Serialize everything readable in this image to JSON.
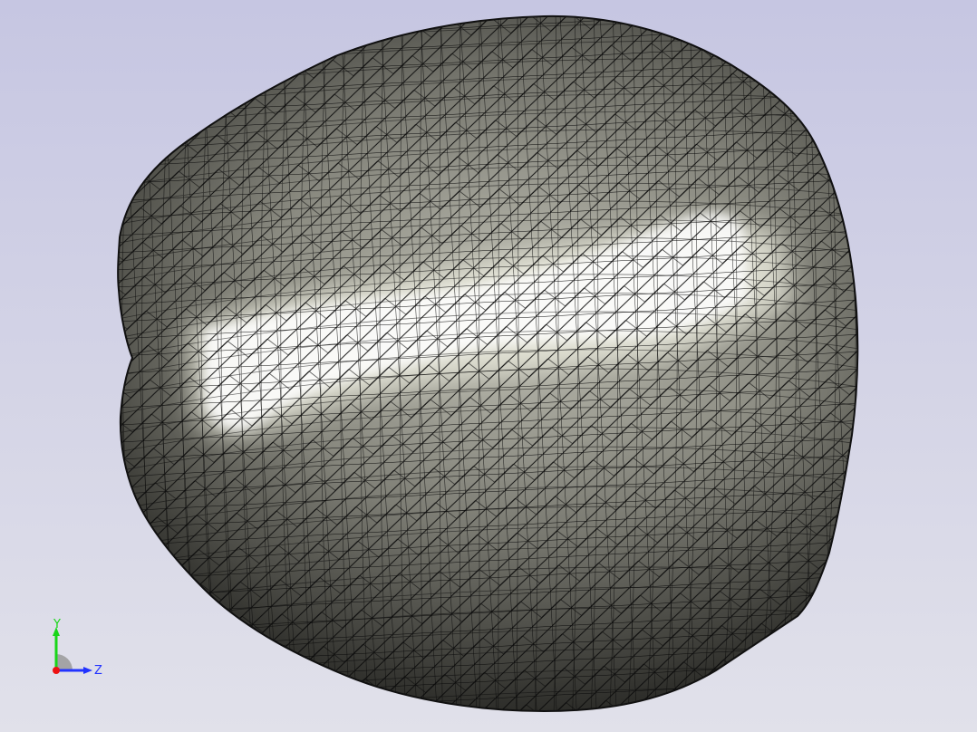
{
  "viewport": {
    "background_top": "#c6c6e2",
    "background_bottom": "#e1e1ea",
    "mesh_color": "#0a0a0a",
    "shaded_colors": {
      "highlight": "#fdfdf6",
      "mid": "#a9a99e",
      "shadow": "#3a3a35"
    }
  },
  "triad": {
    "y_label": "Y",
    "z_label": "Z",
    "y_color": "#19d619",
    "z_color": "#2233ff",
    "x_color": "#ee1111"
  }
}
